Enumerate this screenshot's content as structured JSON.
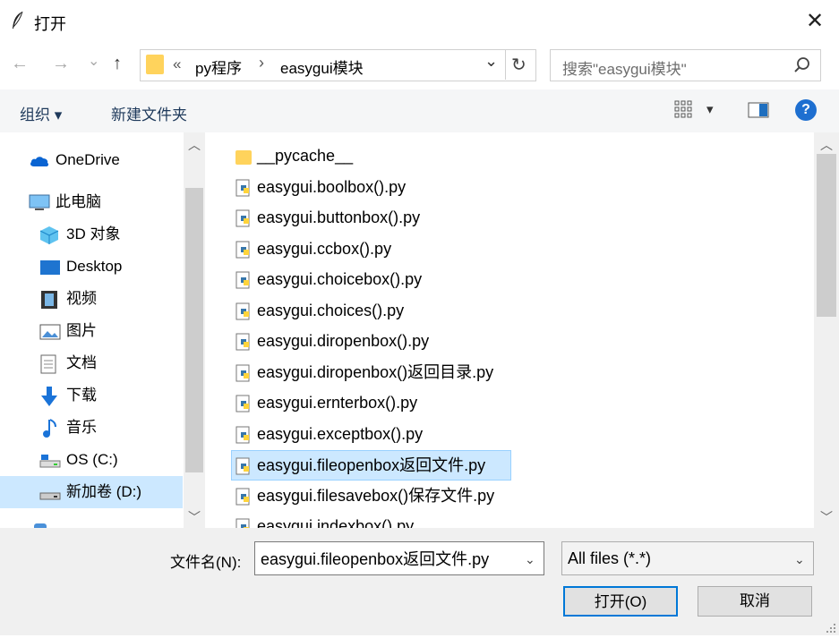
{
  "window": {
    "title": "打开",
    "close_symbol": "✕"
  },
  "nav": {
    "back": "←",
    "forward": "→",
    "recent": "⌄",
    "up": "↑"
  },
  "address": {
    "overflow": "«",
    "segments": [
      "py程序",
      "easygui模块"
    ],
    "separator": "›",
    "dropdown": "⌄",
    "refresh": "↻"
  },
  "search": {
    "placeholder": "搜索\"easygui模块\""
  },
  "toolbar": {
    "organize": "组织 ▾",
    "new_folder": "新建文件夹",
    "view_dropdown": "▾",
    "help": "?"
  },
  "navpane": {
    "items": [
      {
        "label": "OneDrive",
        "icon": "onedrive-icon"
      },
      {
        "label": "此电脑",
        "icon": "computer-icon"
      },
      {
        "label": "3D 对象",
        "icon": "3d-objects-icon"
      },
      {
        "label": "Desktop",
        "icon": "desktop-icon"
      },
      {
        "label": "视频",
        "icon": "video-icon"
      },
      {
        "label": "图片",
        "icon": "pictures-icon"
      },
      {
        "label": "文档",
        "icon": "documents-icon"
      },
      {
        "label": "下载",
        "icon": "download-icon"
      },
      {
        "label": "音乐",
        "icon": "music-icon"
      },
      {
        "label": "OS (C:)",
        "icon": "drive-c-icon"
      },
      {
        "label": "新加卷 (D:)",
        "icon": "drive-d-icon",
        "selected": true
      }
    ]
  },
  "files": [
    {
      "name": "__pycache__",
      "type": "folder"
    },
    {
      "name": "easygui.boolbox().py",
      "type": "py"
    },
    {
      "name": "easygui.buttonbox().py",
      "type": "py"
    },
    {
      "name": "easygui.ccbox().py",
      "type": "py"
    },
    {
      "name": "easygui.choicebox().py",
      "type": "py"
    },
    {
      "name": "easygui.choices().py",
      "type": "py"
    },
    {
      "name": "easygui.diropenbox().py",
      "type": "py"
    },
    {
      "name": "easygui.diropenbox()返回目录.py",
      "type": "py"
    },
    {
      "name": "easygui.ernterbox().py",
      "type": "py"
    },
    {
      "name": "easygui.exceptbox().py",
      "type": "py"
    },
    {
      "name": "easygui.fileopenbox返回文件.py",
      "type": "py",
      "selected": true
    },
    {
      "name": "easygui.filesavebox()保存文件.py",
      "type": "py"
    },
    {
      "name": "easygui.indexbox().py",
      "type": "py"
    }
  ],
  "bottom": {
    "filename_label": "文件名(N):",
    "filename_value": "easygui.fileopenbox返回文件.py",
    "filetype_value": "All files (*.*)",
    "open_button": "打开(O)",
    "cancel_button": "取消"
  },
  "colors": {
    "selection": "#cce8ff",
    "accent": "#0078d7",
    "folder": "#ffd35c"
  }
}
